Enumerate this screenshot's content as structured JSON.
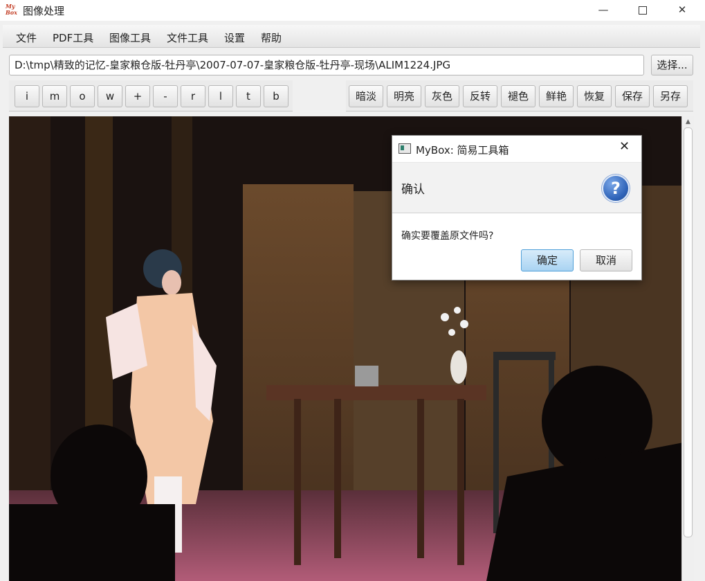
{
  "window": {
    "logo_text": "My Box",
    "title": "图像处理",
    "minimize_glyph": "—",
    "close_glyph": "✕"
  },
  "menu": [
    "文件",
    "PDF工具",
    "图像工具",
    "文件工具",
    "设置",
    "帮助"
  ],
  "path_bar": {
    "value": "D:\\tmp\\精致的记忆-皇家粮仓版-牡丹亭\\2007-07-07-皇家粮仓版-牡丹亭-现场\\ALIM1224.JPG",
    "choose_label": "选择..."
  },
  "toolbar_left": [
    "i",
    "m",
    "o",
    "w",
    "+",
    "-",
    "r",
    "l",
    "t",
    "b"
  ],
  "toolbar_right": [
    "暗淡",
    "明亮",
    "灰色",
    "反转",
    "褪色",
    "鲜艳",
    "恢复",
    "保存",
    "另存"
  ],
  "image": {
    "description_icon": "photo-icon"
  },
  "dialog": {
    "title": "MyBox: 简易工具箱",
    "close_glyph": "✕",
    "heading": "确认",
    "help_glyph": "?",
    "message": "确实要覆盖原文件吗?",
    "ok_label": "确定",
    "cancel_label": "取消"
  },
  "scrollbar": {
    "up_glyph": "▲"
  },
  "colors": {
    "dialog_ok_bg": "#a9d3f2",
    "help_icon": "#2f63b8",
    "image_bg": "#141010"
  }
}
